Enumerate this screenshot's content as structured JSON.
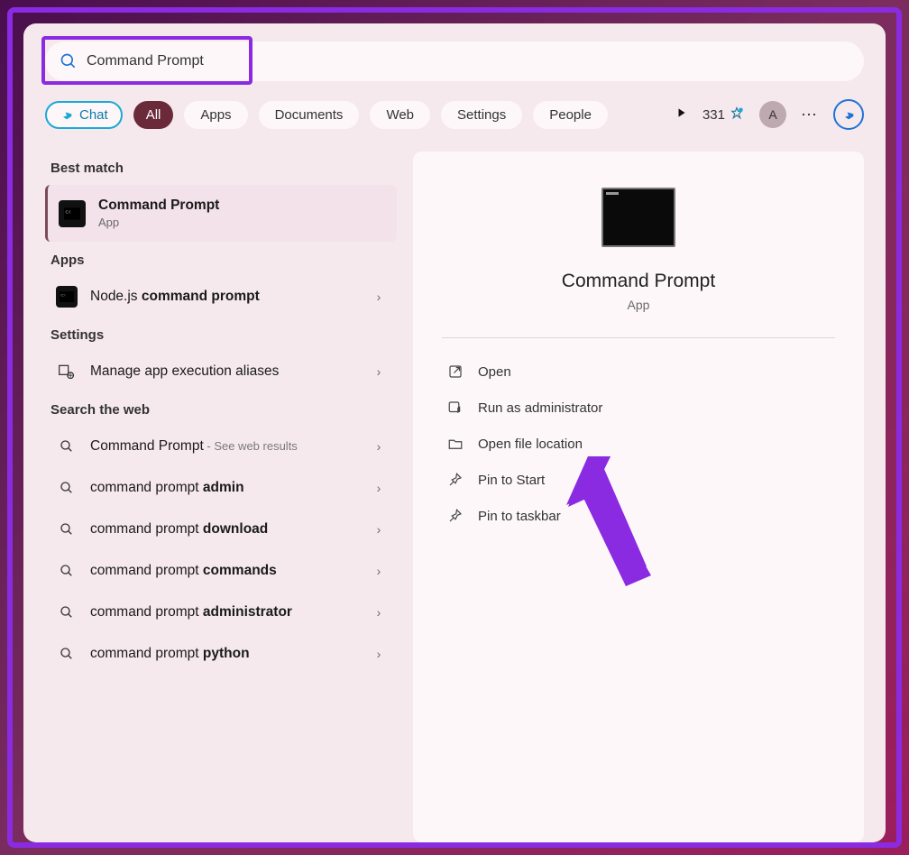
{
  "search": {
    "value": "Command Prompt"
  },
  "tabs": {
    "chat": "Chat",
    "all": "All",
    "apps": "Apps",
    "documents": "Documents",
    "web": "Web",
    "settings": "Settings",
    "people": "People"
  },
  "rewards": {
    "points": "331"
  },
  "account": {
    "initial": "A"
  },
  "sections": {
    "best_match": "Best match",
    "apps": "Apps",
    "settings": "Settings",
    "search_web": "Search the web"
  },
  "best_match": {
    "title": "Command Prompt",
    "subtitle": "App"
  },
  "apps_list": [
    {
      "prefix": "Node.js ",
      "bold": "command prompt"
    }
  ],
  "settings_list": [
    {
      "label": "Manage app execution aliases"
    }
  ],
  "web_list": [
    {
      "prefix": "Command Prompt",
      "bold": "",
      "hint": " - See web results"
    },
    {
      "prefix": "command prompt ",
      "bold": "admin",
      "hint": ""
    },
    {
      "prefix": "command prompt ",
      "bold": "download",
      "hint": ""
    },
    {
      "prefix": "command prompt ",
      "bold": "commands",
      "hint": ""
    },
    {
      "prefix": "command prompt ",
      "bold": "administrator",
      "hint": ""
    },
    {
      "prefix": "command prompt ",
      "bold": "python",
      "hint": ""
    }
  ],
  "detail": {
    "title": "Command Prompt",
    "subtitle": "App",
    "actions": {
      "open": "Open",
      "run_admin": "Run as administrator",
      "open_location": "Open file location",
      "pin_start": "Pin to Start",
      "pin_taskbar": "Pin to taskbar"
    }
  }
}
